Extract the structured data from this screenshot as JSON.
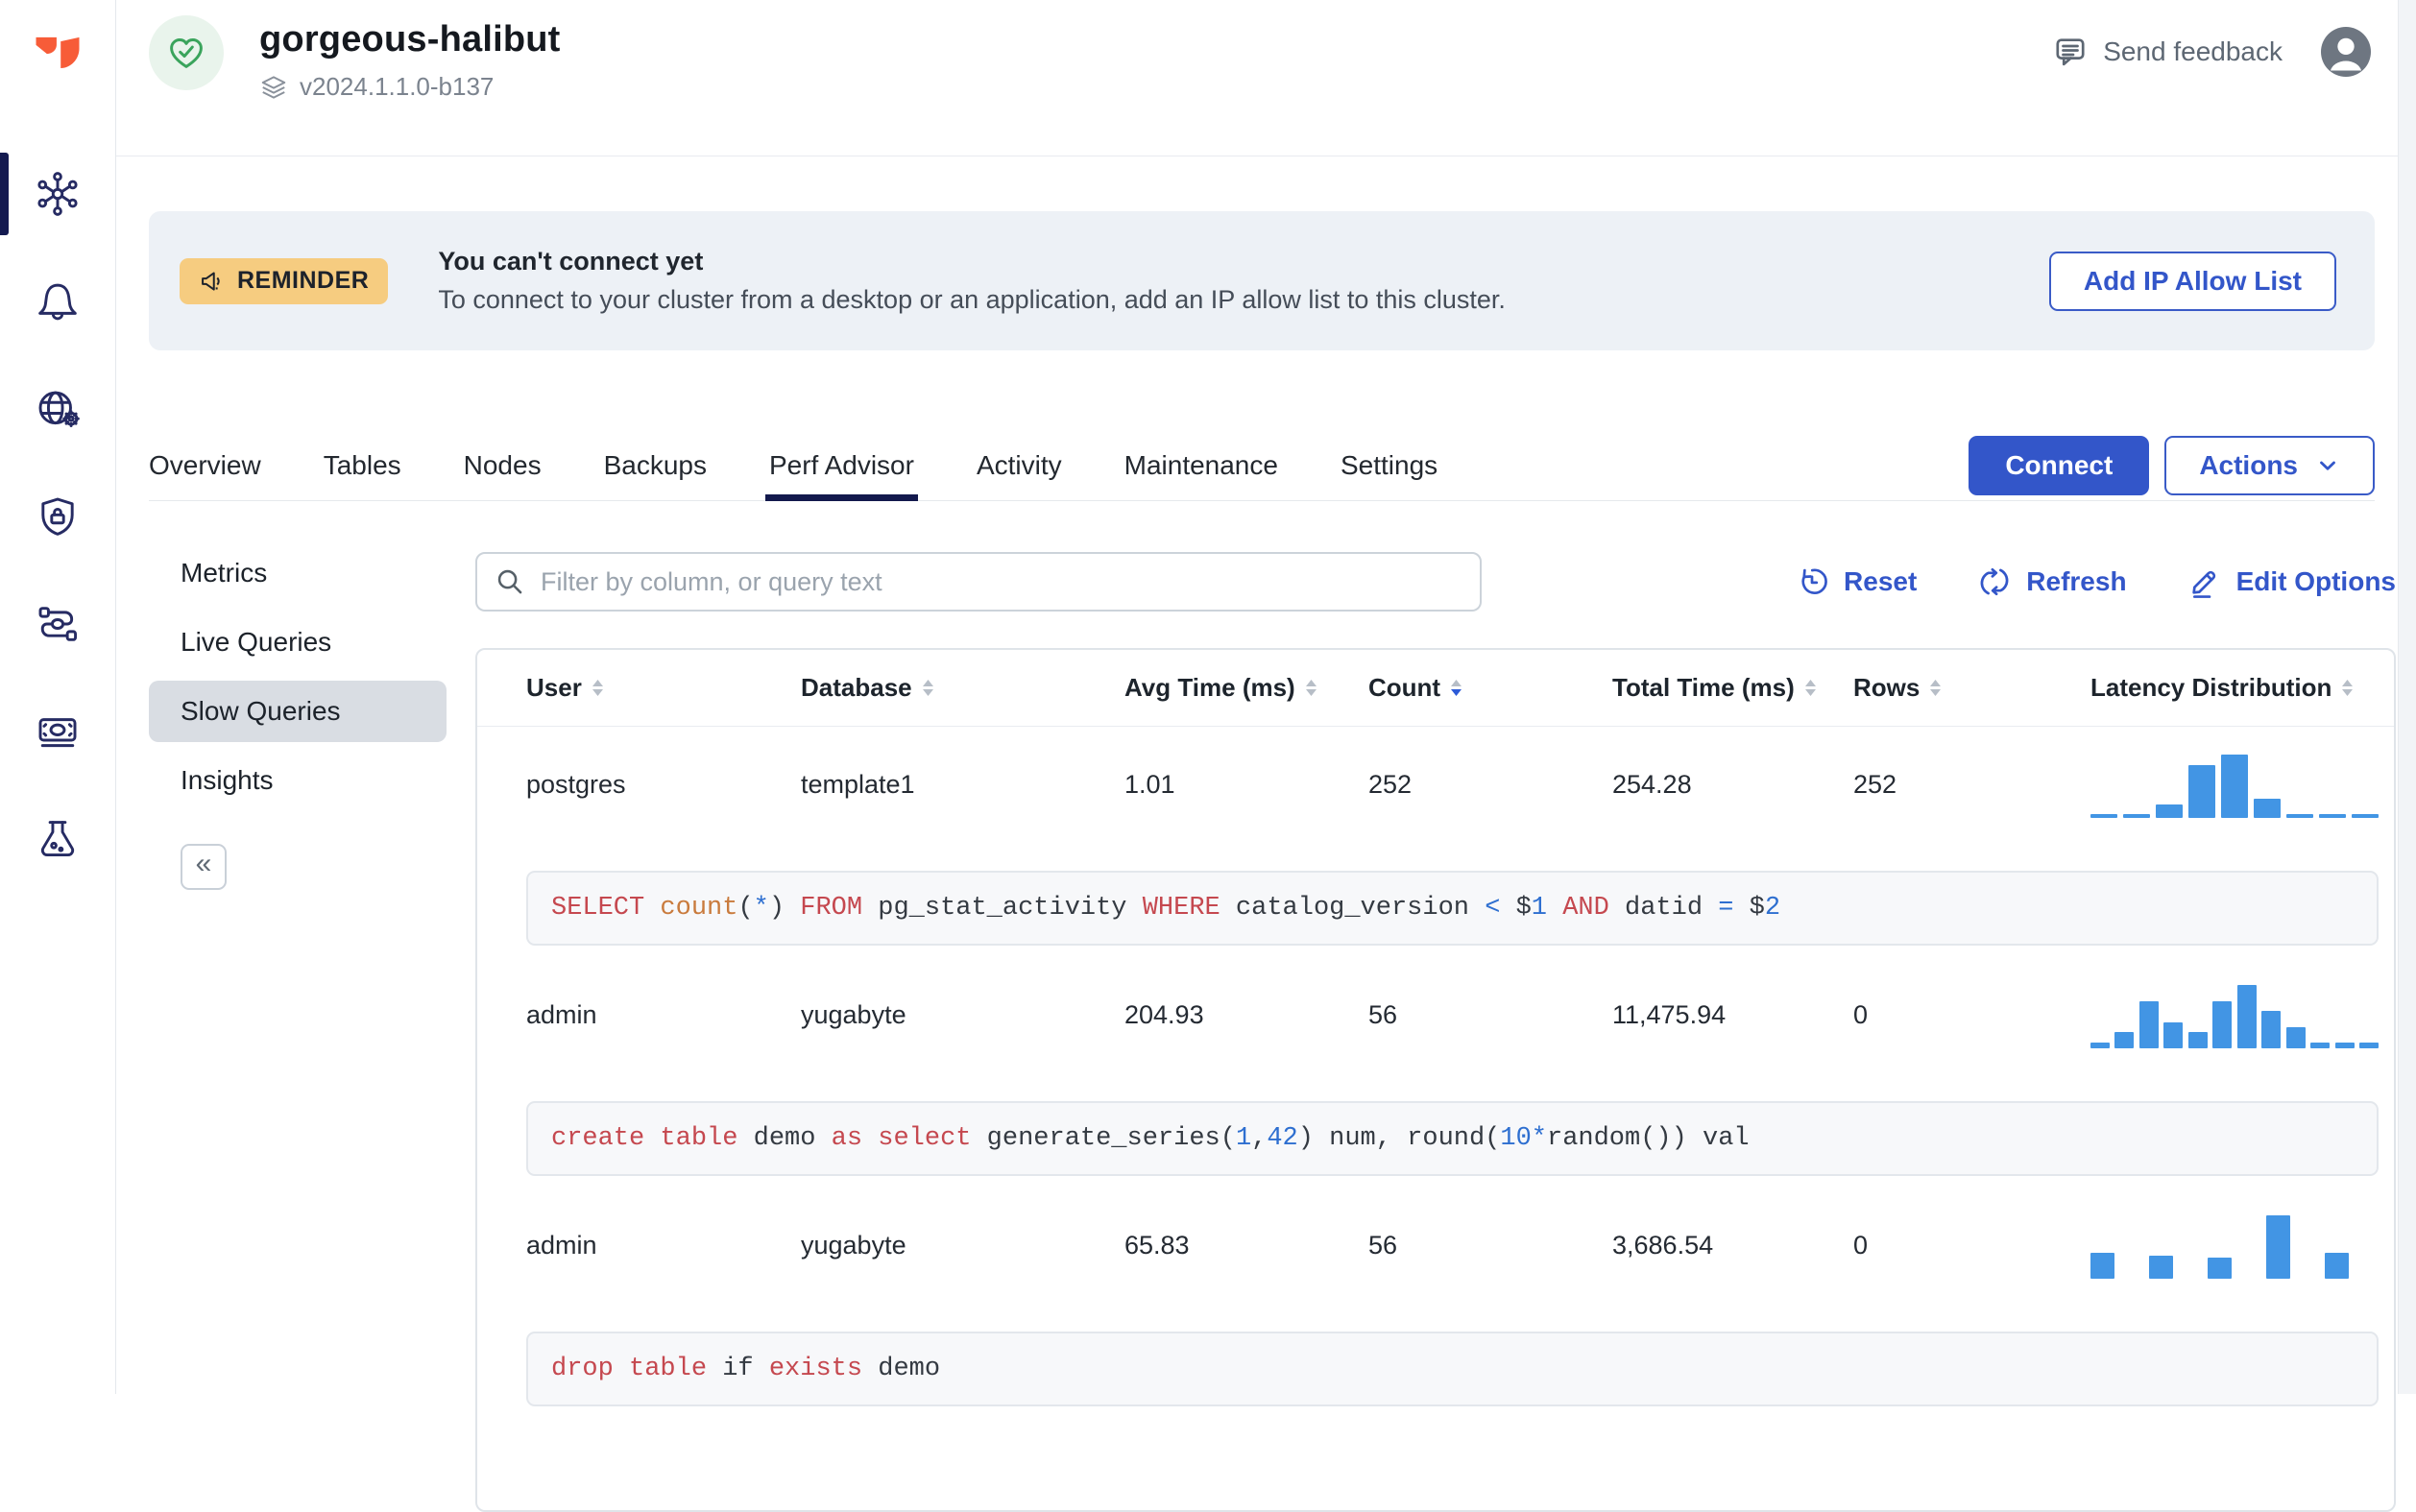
{
  "sidebar": {
    "active_index": 0,
    "icons": [
      "clusters-hub-icon",
      "alerts-bell-icon",
      "network-globe-icon",
      "security-shield-icon",
      "integrations-flow-icon",
      "billing-icon",
      "labs-flask-icon"
    ]
  },
  "header": {
    "title": "gorgeous-halibut",
    "version": "v2024.1.1.0-b137",
    "send_feedback": "Send feedback"
  },
  "banner": {
    "badge": "REMINDER",
    "title": "You can't connect yet",
    "description": "To connect to your cluster from a desktop or an application, add an IP allow list to this cluster.",
    "button": "Add IP Allow List"
  },
  "tabs": {
    "items": [
      "Overview",
      "Tables",
      "Nodes",
      "Backups",
      "Perf Advisor",
      "Activity",
      "Maintenance",
      "Settings"
    ],
    "active": "Perf Advisor",
    "connect": "Connect",
    "actions": "Actions"
  },
  "subnav": {
    "items": [
      "Metrics",
      "Live Queries",
      "Slow Queries",
      "Insights"
    ],
    "active": "Slow Queries",
    "collapse_glyph": "«"
  },
  "toolbar": {
    "filter_placeholder": "Filter by column, or query text",
    "reset": "Reset",
    "refresh": "Refresh",
    "edit_options": "Edit Options"
  },
  "table": {
    "columns": [
      "User",
      "Database",
      "Avg Time (ms)",
      "Count",
      "Total Time (ms)",
      "Rows",
      "Latency Distribution"
    ],
    "sorted_column": "Count",
    "sort_direction": "desc",
    "rows": [
      {
        "user": "postgres",
        "database": "template1",
        "avg_time": "1.01",
        "count": "252",
        "total_time": "254.28",
        "rows": "252",
        "histogram": [
          4,
          4,
          14,
          55,
          66,
          20,
          4,
          4,
          4
        ],
        "query": [
          {
            "c": "kw",
            "t": "SELECT"
          },
          {
            "c": "pl",
            "t": " "
          },
          {
            "c": "fn",
            "t": "count"
          },
          {
            "c": "pl",
            "t": "("
          },
          {
            "c": "nu",
            "t": "*"
          },
          {
            "c": "pl",
            "t": ") "
          },
          {
            "c": "kw",
            "t": "FROM"
          },
          {
            "c": "pl",
            "t": " pg_stat_activity "
          },
          {
            "c": "kw",
            "t": "WHERE"
          },
          {
            "c": "pl",
            "t": " catalog_version "
          },
          {
            "c": "nu",
            "t": "<"
          },
          {
            "c": "pl",
            "t": " $"
          },
          {
            "c": "nu",
            "t": "1"
          },
          {
            "c": "pl",
            "t": " "
          },
          {
            "c": "kw",
            "t": "AND"
          },
          {
            "c": "pl",
            "t": " datid "
          },
          {
            "c": "nu",
            "t": "="
          },
          {
            "c": "pl",
            "t": " $"
          },
          {
            "c": "nu",
            "t": "2"
          }
        ]
      },
      {
        "user": "admin",
        "database": "yugabyte",
        "avg_time": "204.93",
        "count": "56",
        "total_time": "11,475.94",
        "rows": "0",
        "histogram": [
          6,
          17,
          49,
          27,
          17,
          49,
          66,
          39,
          22,
          6,
          6,
          6
        ],
        "query": [
          {
            "c": "kw",
            "t": "create table"
          },
          {
            "c": "pl",
            "t": " demo "
          },
          {
            "c": "kw",
            "t": "as"
          },
          {
            "c": "pl",
            "t": " "
          },
          {
            "c": "kw",
            "t": "select"
          },
          {
            "c": "pl",
            "t": " generate_series("
          },
          {
            "c": "nu",
            "t": "1"
          },
          {
            "c": "pl",
            "t": ","
          },
          {
            "c": "nu",
            "t": "42"
          },
          {
            "c": "pl",
            "t": ") num, round("
          },
          {
            "c": "nu",
            "t": "10"
          },
          {
            "c": "nu",
            "t": "*"
          },
          {
            "c": "pl",
            "t": "random()) val"
          }
        ]
      },
      {
        "user": "admin",
        "database": "yugabyte",
        "avg_time": "65.83",
        "count": "56",
        "total_time": "3,686.54",
        "rows": "0",
        "histogram": [
          27,
          0,
          24,
          0,
          22,
          0,
          66,
          0,
          27,
          0
        ],
        "query": [
          {
            "c": "kw",
            "t": "drop table"
          },
          {
            "c": "pl",
            "t": " if "
          },
          {
            "c": "kw",
            "t": "exists"
          },
          {
            "c": "pl",
            "t": " demo"
          }
        ]
      }
    ]
  },
  "colors": {
    "accent_blue": "#3356c9",
    "histogram_bar": "#4295e4",
    "banner_bg": "#edf1f6",
    "badge_bg": "#f6cc80",
    "tab_underline": "#13194d",
    "success_green": "#3aa45c",
    "sidebar_icon": "#262b63",
    "sql_keyword": "#c5484f",
    "sql_function": "#c97b3d",
    "sql_number": "#2e6fd0",
    "sql_plain": "#343a42"
  }
}
